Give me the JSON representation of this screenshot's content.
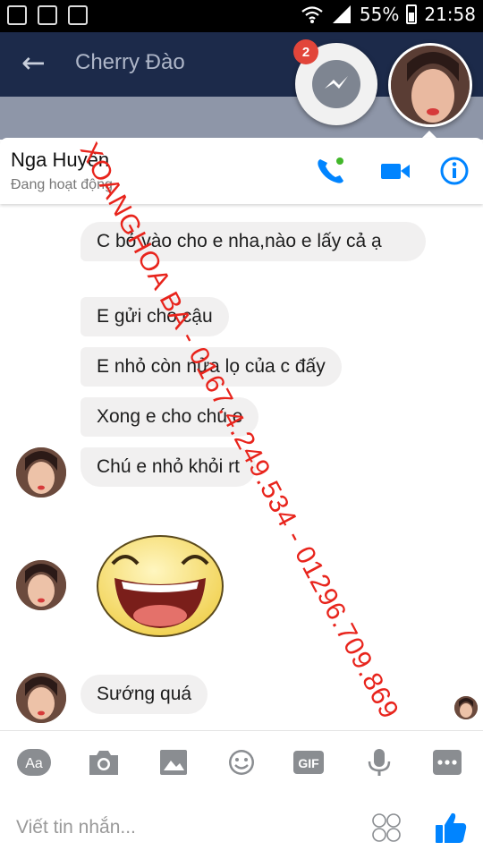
{
  "status_bar": {
    "battery": "55%",
    "time": "21:58"
  },
  "background_app": {
    "title": "Cherry Đào"
  },
  "chat_heads": {
    "badge_count": "2"
  },
  "chat": {
    "contact_name": "Nga Huyền",
    "contact_status": "Đang hoạt động",
    "messages": [
      {
        "text": "C bỏ vào cho e nha,nào e lấy cả ạ"
      },
      {
        "text": "E gửi cho cậu"
      },
      {
        "text": "E nhỏ còn nửa lọ của c đấy"
      },
      {
        "text": "Xong e cho chú e"
      },
      {
        "text": "Chú e nhỏ khỏi rt"
      },
      {
        "text": "Sướng quá"
      }
    ]
  },
  "composer": {
    "placeholder": "Viết tin nhắn...",
    "aa_label": "Aa",
    "gif_label": "GIF"
  },
  "watermark": "XOANGHOA BA - 0167.4.249.534 - 01296.709.869",
  "colors": {
    "accent": "#0084ff",
    "bubble": "#f1f0f0",
    "watermark": "#e8241c",
    "badge": "#e2453a"
  }
}
